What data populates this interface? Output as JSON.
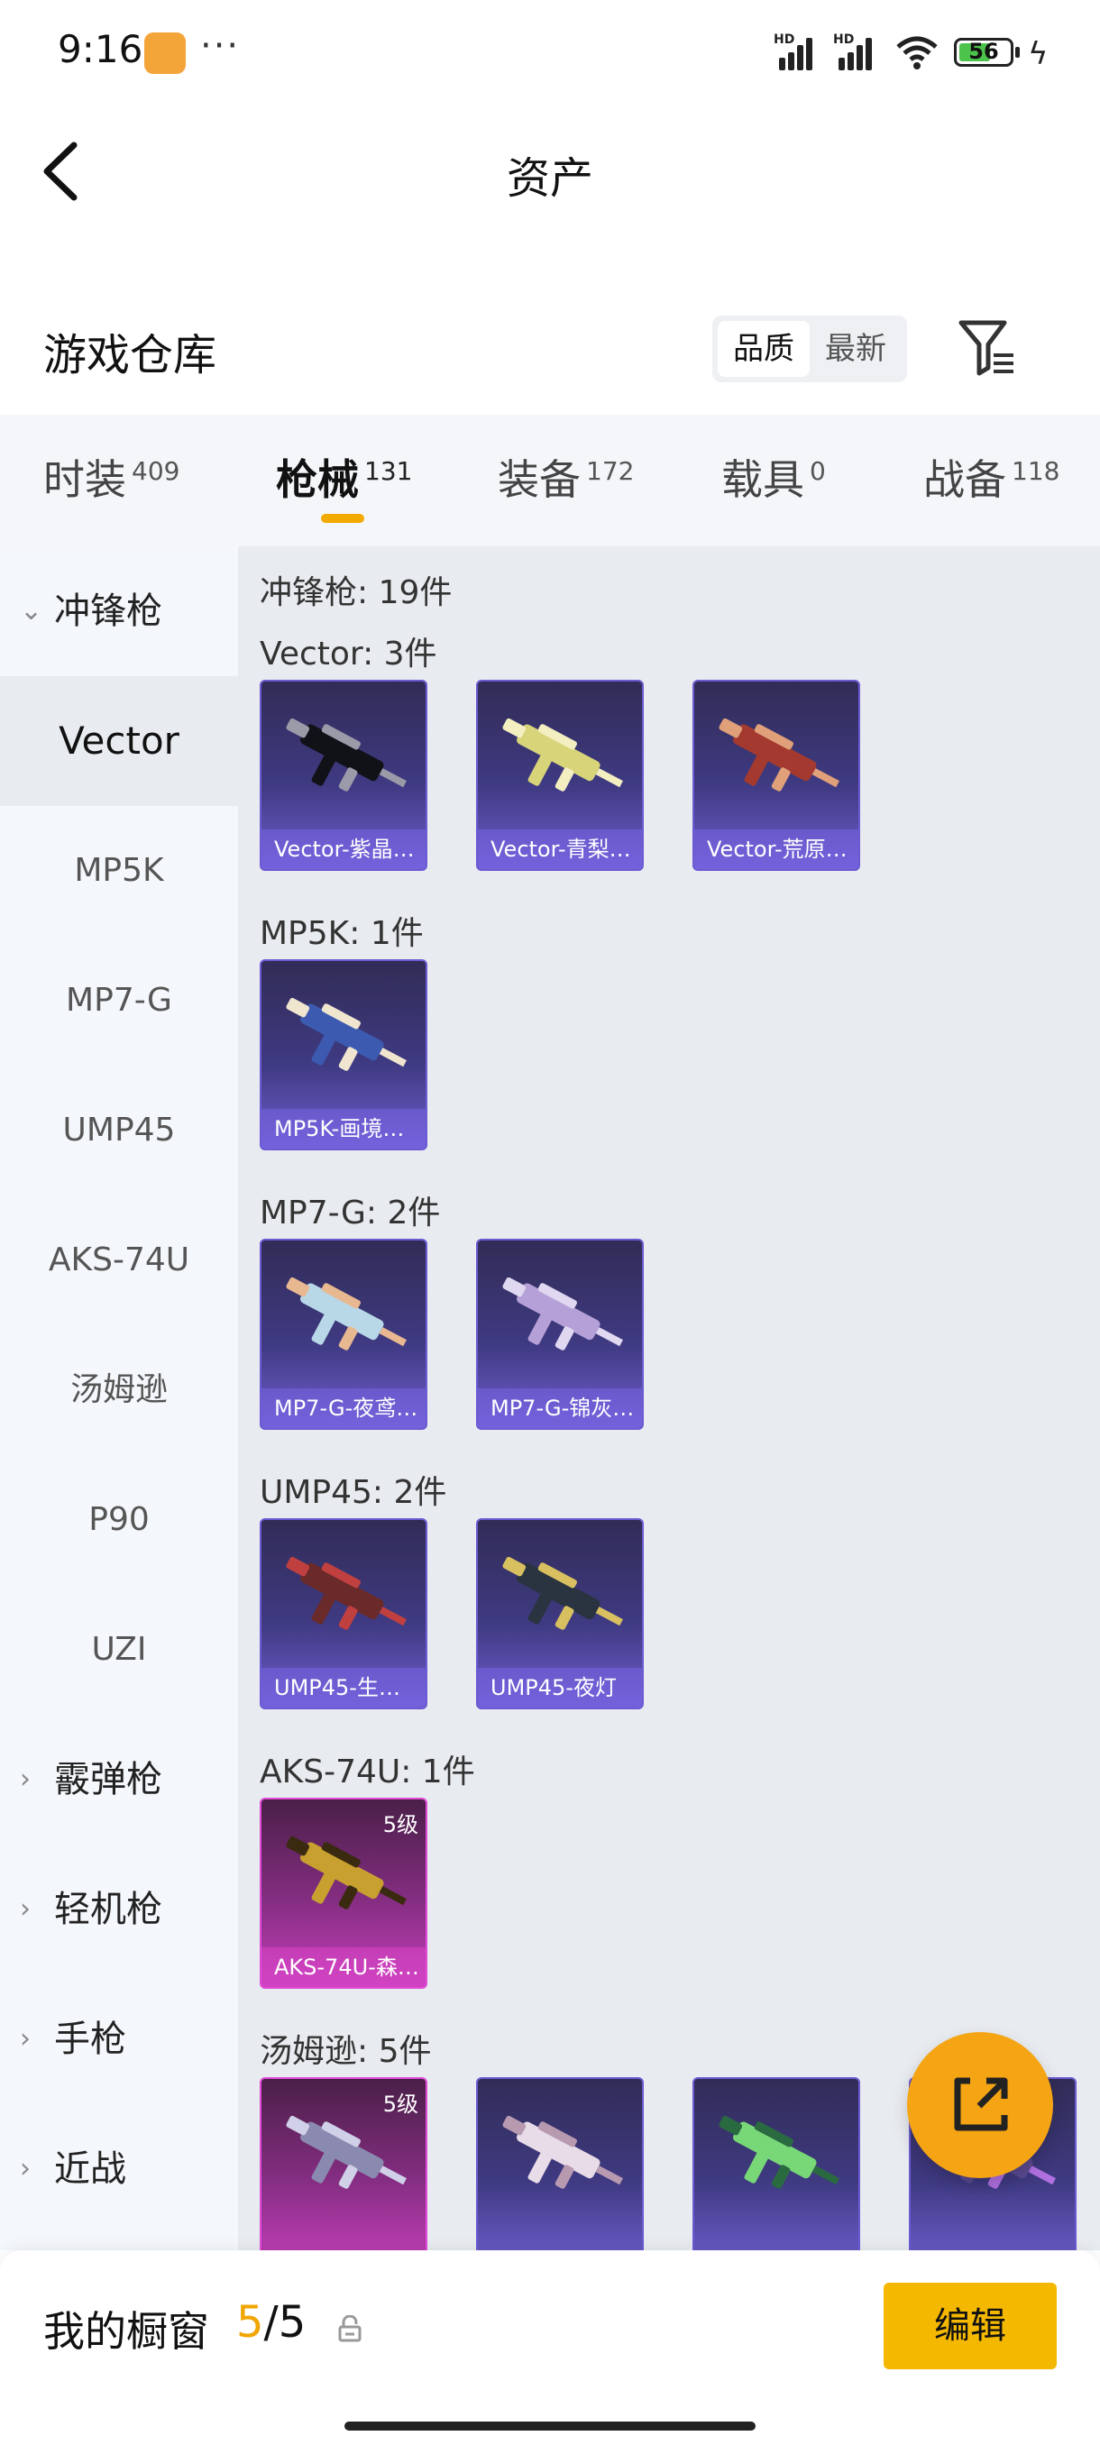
{
  "status": {
    "time": "9:16",
    "dots": "···",
    "hd1": "HD",
    "hd2": "HD",
    "battery": "56"
  },
  "nav": {
    "title": "资产"
  },
  "header": {
    "title": "游戏仓库",
    "sort_options": [
      "品质",
      "最新"
    ]
  },
  "tabs": [
    {
      "label": "时装",
      "count": "409"
    },
    {
      "label": "枪械",
      "count": "131"
    },
    {
      "label": "装备",
      "count": "172"
    },
    {
      "label": "载具",
      "count": "0"
    },
    {
      "label": "战备",
      "count": "118"
    }
  ],
  "sidebar": [
    {
      "label": "冲锋枪",
      "type": "group-open"
    },
    {
      "label": "Vector",
      "type": "sel"
    },
    {
      "label": "MP5K",
      "type": "item"
    },
    {
      "label": "MP7-G",
      "type": "item"
    },
    {
      "label": "UMP45",
      "type": "item"
    },
    {
      "label": "AKS-74U",
      "type": "item"
    },
    {
      "label": "汤姆逊",
      "type": "item"
    },
    {
      "label": "P90",
      "type": "item"
    },
    {
      "label": "UZI",
      "type": "item"
    },
    {
      "label": "霰弹枪",
      "type": "group"
    },
    {
      "label": "轻机枪",
      "type": "group"
    },
    {
      "label": "手枪",
      "type": "group"
    },
    {
      "label": "近战",
      "type": "group"
    }
  ],
  "main": {
    "category_title": "冲锋枪: 19件",
    "sections": [
      {
        "title": "Vector: 3件",
        "items": [
          {
            "label": "Vector-紫晶…",
            "gun": "#111118",
            "accent": "#9a9aa8"
          },
          {
            "label": "Vector-青梨…",
            "gun": "#d8d47a",
            "accent": "#f3efc0"
          },
          {
            "label": "Vector-荒原…",
            "gun": "#a43a2f",
            "accent": "#e0a07a"
          }
        ]
      },
      {
        "title": "MP5K: 1件",
        "items": [
          {
            "label": "MP5K-画境…",
            "gun": "#3c5ab0",
            "accent": "#f0e6d0"
          }
        ]
      },
      {
        "title": "MP7-G: 2件",
        "items": [
          {
            "label": "MP7-G-夜鸢…",
            "gun": "#b8d8e8",
            "accent": "#e8b890"
          },
          {
            "label": "MP7-G-锦灰…",
            "gun": "#b6a0d8",
            "accent": "#e0d8f0"
          }
        ]
      },
      {
        "title": "UMP45: 2件",
        "items": [
          {
            "label": "UMP45-生…",
            "gun": "#6a2a2a",
            "accent": "#c04040"
          },
          {
            "label": "UMP45-夜灯",
            "gun": "#2a3440",
            "accent": "#d8c060"
          }
        ]
      },
      {
        "title": "AKS-74U: 1件",
        "items": [
          {
            "label": "AKS-74U-森…",
            "gun": "#c8a030",
            "accent": "#3a2a10",
            "level": "5级",
            "rare": true
          }
        ]
      },
      {
        "title": "汤姆逊: 5件",
        "items": [
          {
            "label": "",
            "gun": "#8a8ab0",
            "accent": "#d0d0e8",
            "level": "5级",
            "rare": true
          },
          {
            "label": "",
            "gun": "#e8dce8",
            "accent": "#b89ab0"
          },
          {
            "label": "",
            "gun": "#78d878",
            "accent": "#2a6a40"
          },
          {
            "label": "",
            "gun": "#5a4a90",
            "accent": "#b070e0"
          }
        ]
      }
    ]
  },
  "bottom": {
    "title": "我的橱窗",
    "count_a": "5",
    "count_b": "/5",
    "edit": "编辑"
  }
}
